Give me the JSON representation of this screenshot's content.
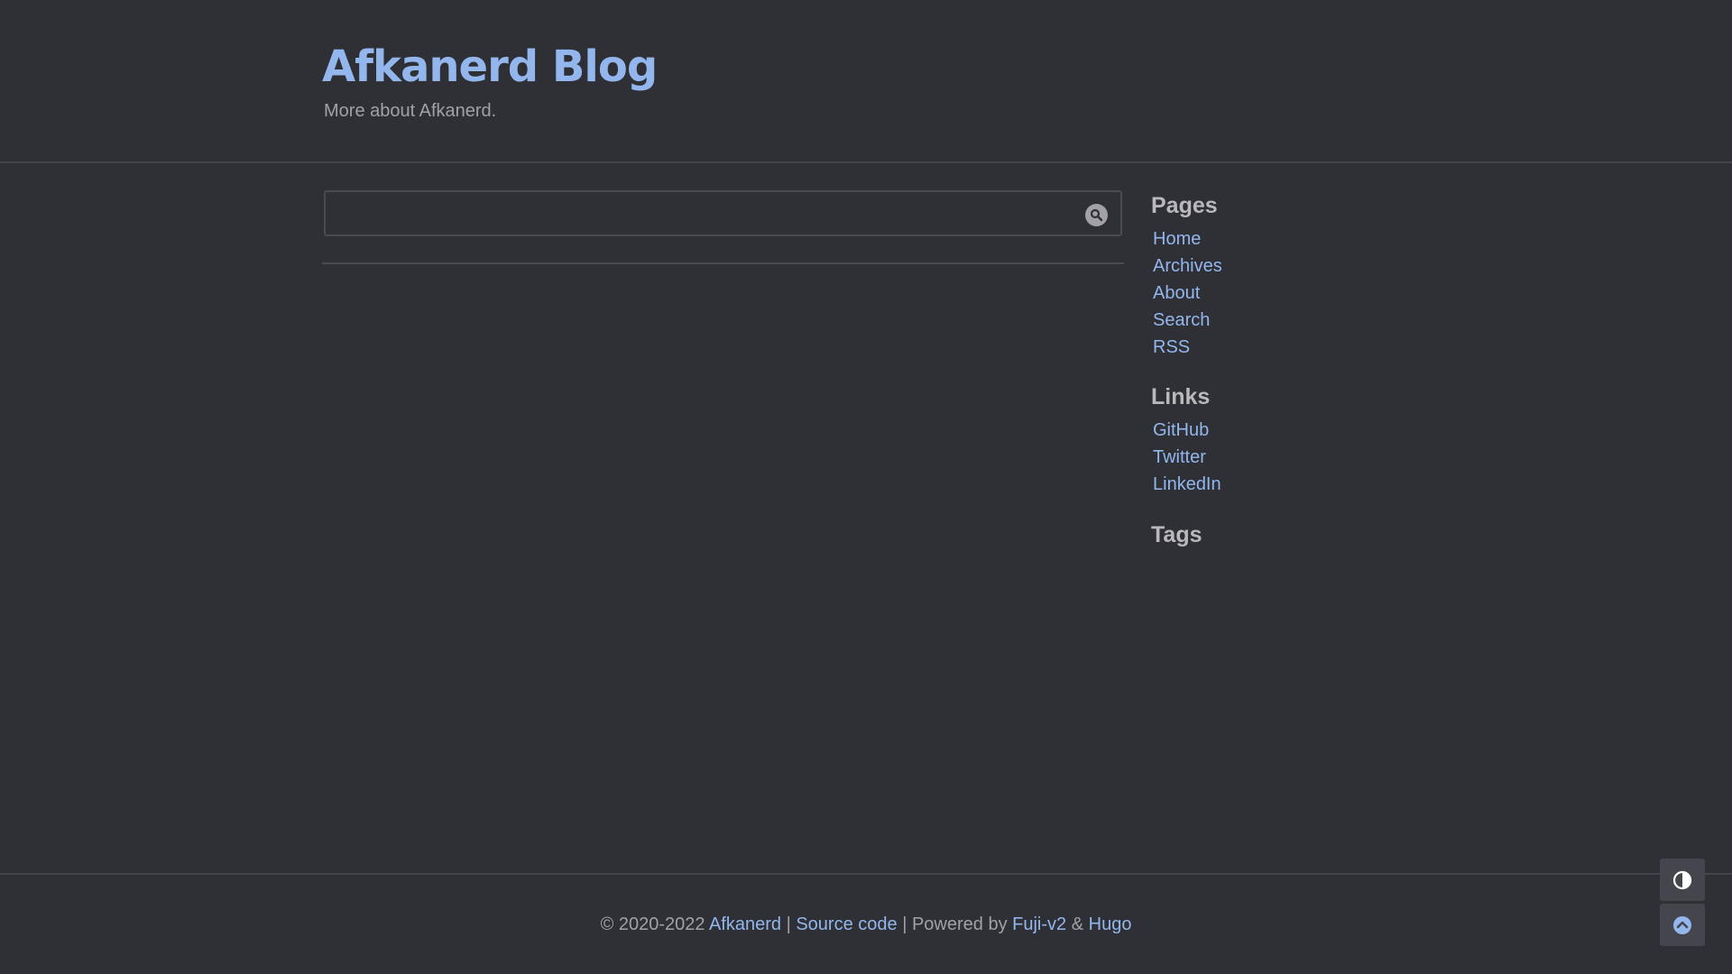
{
  "header": {
    "title": "Afkanerd Blog",
    "subtitle": "More about Afkanerd."
  },
  "search": {
    "value": "",
    "placeholder": "",
    "icon": "search-icon"
  },
  "sidebar": {
    "pages": {
      "heading": "Pages",
      "items": [
        {
          "label": "Home"
        },
        {
          "label": "Archives"
        },
        {
          "label": "About"
        },
        {
          "label": "Search"
        },
        {
          "label": "RSS"
        }
      ]
    },
    "links": {
      "heading": "Links",
      "items": [
        {
          "label": "GitHub"
        },
        {
          "label": "Twitter"
        },
        {
          "label": "LinkedIn"
        }
      ]
    },
    "tags": {
      "heading": "Tags"
    }
  },
  "footer": {
    "copyright": "© 2020-2022",
    "author_link": "Afkanerd",
    "sep1": "|",
    "source_link": "Source code",
    "sep2": "| Powered by",
    "theme_link": "Fuji-v2",
    "amp": "&",
    "engine_link": "Hugo"
  },
  "floating": {
    "theme_toggle_icon": "contrast-icon",
    "back_to_top_icon": "chevron-up-icon"
  },
  "colors": {
    "background": "#2f3036",
    "accent": "#93b6ec",
    "muted_text": "#a1a1a7",
    "divider": "#45464d"
  }
}
